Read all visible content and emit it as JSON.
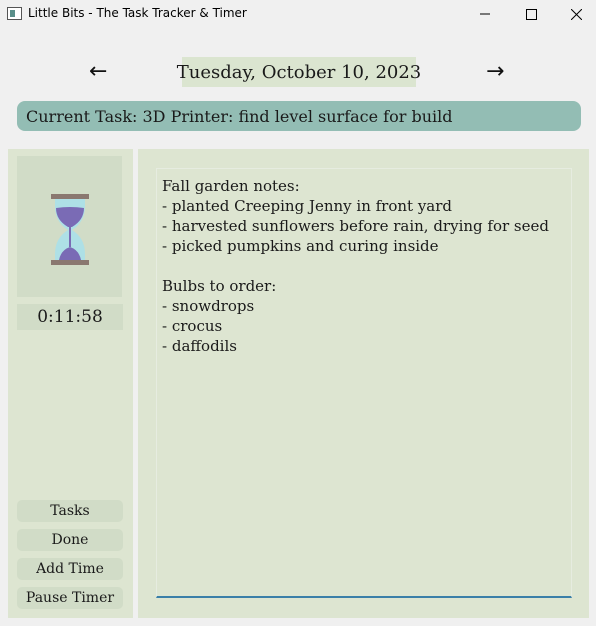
{
  "window": {
    "title": "Little Bits - The Task Tracker & Timer",
    "icon": "app-window-icon",
    "controls": [
      "minimize-icon",
      "maximize-icon",
      "close-icon"
    ]
  },
  "date_nav": {
    "prev_label": "←",
    "date": "Tuesday, October 10, 2023",
    "next_label": "→"
  },
  "current_task": {
    "text": "Current Task: 3D Printer: find level surface for build"
  },
  "timer_panel": {
    "icon": "hourglass-icon",
    "elapsed": "0:11:58",
    "buttons": {
      "tasks": "Tasks",
      "done": "Done",
      "add_time": "Add Time",
      "pause_timer": "Pause Timer"
    }
  },
  "notes": {
    "lines": [
      "Fall garden notes:",
      "- planted Creeping Jenny in front yard",
      "- harvested sunflowers before rain, drying for seed",
      "- picked pumpkins and curing inside",
      "",
      "Bulbs to order:",
      "- snowdrops",
      "- crocus",
      "- daffodils"
    ]
  },
  "colors": {
    "window_bg": "#f0f0f0",
    "panel_bg": "#dde5d1",
    "button_bg": "#d1dcc7",
    "current_task_bg": "#93bdb4",
    "date_bg": "#dbe5d0",
    "hourglass_sand": "#7a6bb5",
    "hourglass_glass": "#aee0e6",
    "hourglass_frame": "#8a7870",
    "notes_focus_border": "#3a7fa8"
  }
}
